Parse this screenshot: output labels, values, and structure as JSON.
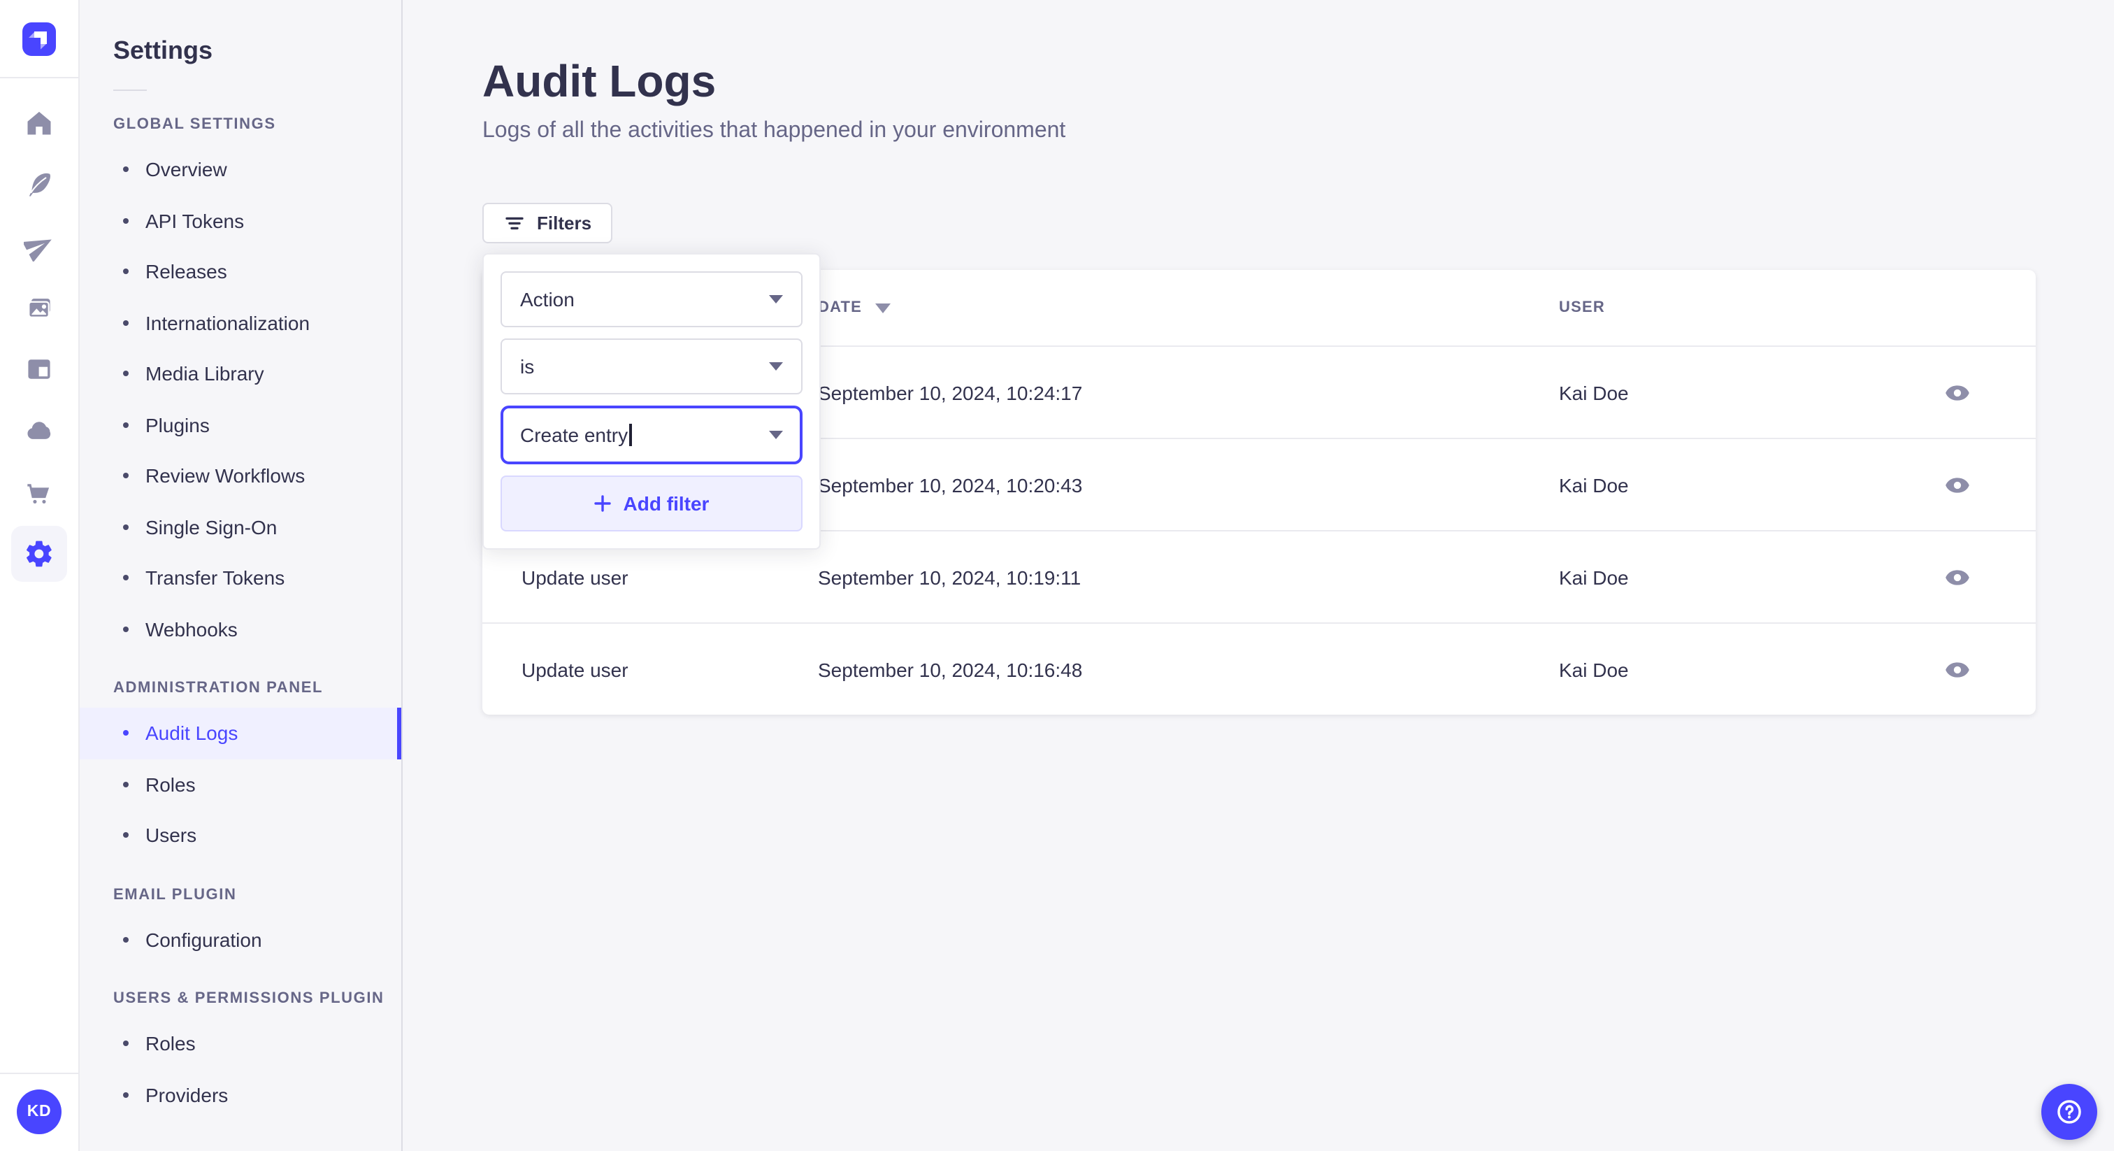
{
  "rail": {
    "logo_icon": "strapi-logo",
    "nav_icons": [
      "home-icon",
      "feather-icon",
      "paper-plane-icon",
      "media-library-icon",
      "layout-icon",
      "cloud-icon",
      "cart-icon",
      "settings-gear-icon"
    ],
    "active_icon": "settings-gear-icon",
    "avatar_initials": "KD"
  },
  "sidebar": {
    "title": "Settings",
    "sections": [
      {
        "label": "GLOBAL SETTINGS",
        "items": [
          {
            "label": "Overview"
          },
          {
            "label": "API Tokens"
          },
          {
            "label": "Releases"
          },
          {
            "label": "Internationalization"
          },
          {
            "label": "Media Library"
          },
          {
            "label": "Plugins"
          },
          {
            "label": "Review Workflows"
          },
          {
            "label": "Single Sign-On"
          },
          {
            "label": "Transfer Tokens"
          },
          {
            "label": "Webhooks"
          }
        ]
      },
      {
        "label": "ADMINISTRATION PANEL",
        "items": [
          {
            "label": "Audit Logs",
            "active": true
          },
          {
            "label": "Roles"
          },
          {
            "label": "Users"
          }
        ]
      },
      {
        "label": "EMAIL PLUGIN",
        "items": [
          {
            "label": "Configuration"
          }
        ]
      },
      {
        "label": "USERS & PERMISSIONS PLUGIN",
        "items": [
          {
            "label": "Roles"
          },
          {
            "label": "Providers"
          }
        ]
      }
    ]
  },
  "main": {
    "title": "Audit Logs",
    "subtitle": "Logs of all the activities that happened in your environment",
    "filters_button": {
      "label": "Filters",
      "icon": "filter-icon"
    },
    "filter_popover": {
      "field_select": {
        "value": "Action",
        "icon": "chevron-down-icon"
      },
      "operator_select": {
        "value": "is",
        "icon": "chevron-down-icon"
      },
      "value_select": {
        "value": "Create entry",
        "icon": "chevron-down-icon",
        "focused": true
      },
      "add_filter_button": {
        "label": "Add filter",
        "icon": "plus-icon"
      }
    },
    "table": {
      "headers": {
        "action": "",
        "date": "DATE",
        "user": "USER"
      },
      "sort": {
        "column": "DATE",
        "direction": "desc",
        "icon": "sort-descending-icon"
      },
      "row_action_icon": "eye-icon",
      "rows": [
        {
          "action": "",
          "date": "September 10, 2024, 10:24:17",
          "user": "Kai Doe"
        },
        {
          "action": "",
          "date": "September 10, 2024, 10:20:43",
          "user": "Kai Doe"
        },
        {
          "action": "Update user",
          "date": "September 10, 2024, 10:19:11",
          "user": "Kai Doe"
        },
        {
          "action": "Update user",
          "date": "September 10, 2024, 10:16:48",
          "user": "Kai Doe"
        }
      ]
    }
  },
  "help_button": {
    "icon": "question-mark-icon"
  },
  "colors": {
    "primary": "#4945ff",
    "primary_light": "#f0f0ff",
    "text_dark": "#32324d",
    "text_muted": "#666687",
    "icon_grey": "#8e8ea9",
    "border": "#dcdce4",
    "background": "#f6f6f9",
    "surface": "#ffffff"
  }
}
